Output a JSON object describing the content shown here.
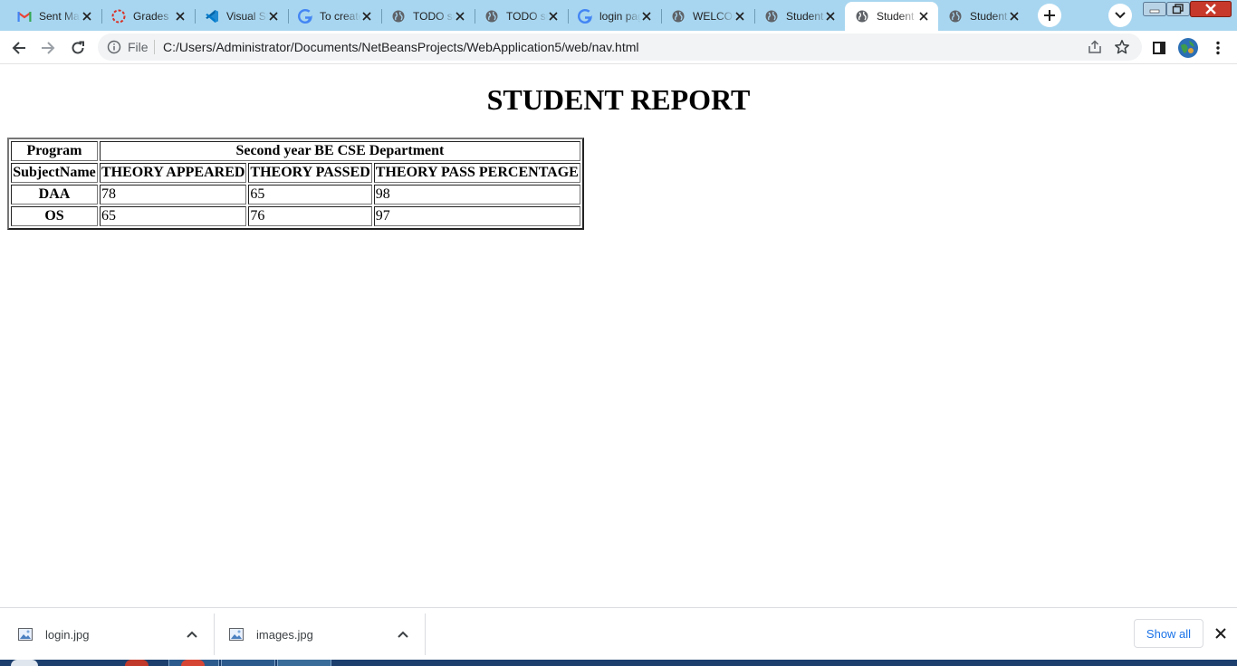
{
  "browser": {
    "tabs": [
      {
        "title": "Sent Mail - Gmail",
        "icon": "gmail-icon"
      },
      {
        "title": "Grades",
        "icon": "loading-spinner-icon"
      },
      {
        "title": "Visual Studio Code",
        "icon": "vscode-icon"
      },
      {
        "title": "To create",
        "icon": "google-icon"
      },
      {
        "title": "TODO supply a title",
        "icon": "globe-icon"
      },
      {
        "title": "TODO supply a title",
        "icon": "globe-icon"
      },
      {
        "title": "login page",
        "icon": "google-icon"
      },
      {
        "title": "WELCOME",
        "icon": "globe-icon"
      },
      {
        "title": "Student Report",
        "icon": "globe-icon"
      },
      {
        "title": "Student Report",
        "icon": "globe-icon",
        "active": true
      },
      {
        "title": "Student Report",
        "icon": "globe-icon"
      }
    ],
    "address": {
      "scheme_label": "File",
      "url": "C:/Users/Administrator/Documents/NetBeansProjects/WebApplication5/web/nav.html"
    }
  },
  "page": {
    "title": "STUDENT REPORT",
    "table": {
      "program_label": "Program",
      "program_value": "Second year BE CSE Department",
      "headers": [
        "SubjectName",
        "THEORY APPEARED",
        "THEORY PASSED",
        "THEORY PASS PERCENTAGE"
      ],
      "rows": [
        {
          "subject": "DAA",
          "appeared": "78",
          "passed": "65",
          "percentage": "98"
        },
        {
          "subject": "OS",
          "appeared": "65",
          "passed": "76",
          "percentage": "97"
        }
      ]
    }
  },
  "downloads": {
    "items": [
      {
        "name": "login.jpg"
      },
      {
        "name": "images.jpg"
      }
    ],
    "show_all_label": "Show all"
  },
  "colors": {
    "tabstrip": "#a8d6f0",
    "accent_blue": "#1a73e8"
  }
}
